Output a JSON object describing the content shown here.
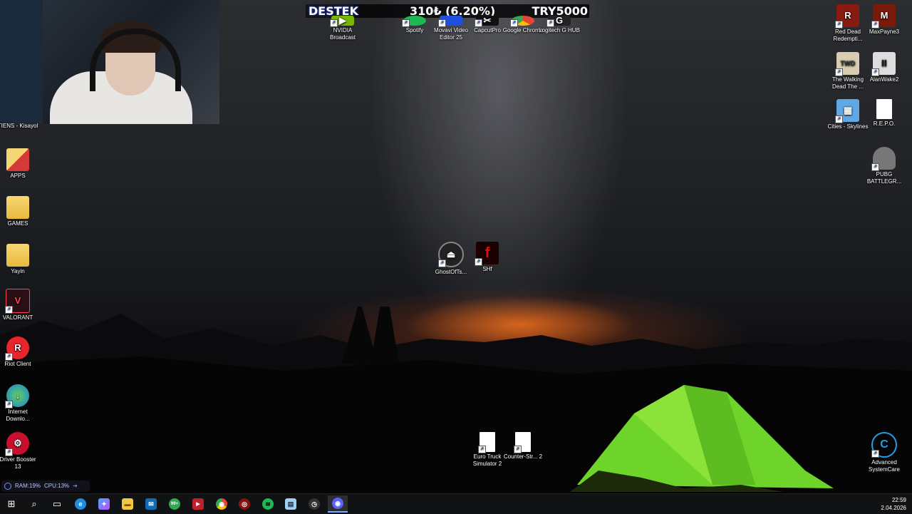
{
  "desktop_left": [
    {
      "label": "TIENS - Kisayol",
      "icon": "tiens-shortcut-icon"
    },
    {
      "label": "APPS",
      "icon": "apps-folder-icon"
    },
    {
      "label": "GAMES",
      "icon": "games-folder-icon"
    },
    {
      "label": "Yayin",
      "icon": "yayin-folder-icon"
    },
    {
      "label": "VALORANT",
      "icon": "valorant-icon"
    },
    {
      "label": "Riot Client",
      "icon": "riot-client-icon"
    },
    {
      "label": "Internet Downlo...",
      "icon": "internet-download-manager-icon"
    },
    {
      "label": "Driver Booster 13",
      "icon": "driver-booster-icon"
    }
  ],
  "desktop_top": [
    {
      "label": "NVIDIA Broadcast",
      "icon": "nvidia-broadcast-icon"
    },
    {
      "label": "Spotify",
      "icon": "spotify-icon"
    },
    {
      "label": "Movavi Video Editor 25",
      "icon": "movavi-icon"
    },
    {
      "label": "CapcutPro",
      "icon": "capcut-icon"
    },
    {
      "label": "Google Chrome",
      "icon": "chrome-icon"
    },
    {
      "label": "Logitech G HUB",
      "icon": "logitech-ghub-icon"
    }
  ],
  "desktop_center": [
    {
      "label": "GhostOfTs...",
      "icon": "ghost-of-tsushima-icon"
    },
    {
      "label": "SHf",
      "icon": "shf-icon"
    }
  ],
  "desktop_bottom": [
    {
      "label": "Euro Truck Simulator 2",
      "icon": "file-icon"
    },
    {
      "label": "Counter-Str... 2",
      "icon": "file-icon"
    }
  ],
  "desktop_right": [
    {
      "label": "Red Dead Redempti...",
      "icon": "red-dead-icon"
    },
    {
      "label": "MaxPayne3",
      "icon": "max-payne-icon"
    },
    {
      "label": "The Walking Dead The ...",
      "icon": "walking-dead-icon"
    },
    {
      "label": "AlanWake2",
      "icon": "alan-wake-icon"
    },
    {
      "label": "Cities - Skylines",
      "icon": "cities-skylines-icon"
    },
    {
      "label": "R.E.P.O.",
      "icon": "file-icon"
    },
    {
      "label": "PUBG BATTLEGR...",
      "icon": "pubg-icon"
    },
    {
      "label": "Advanced SystemCare",
      "icon": "advanced-systemcare-icon"
    }
  ],
  "banner": {
    "label": "DESTEK",
    "amount": "310₺ (6.20%)",
    "goal": "TRY5000",
    "progress": 0.062
  },
  "perf": {
    "ram": "RAM:19%",
    "cpu": "CPU:13%"
  },
  "taskbar": {
    "items": [
      {
        "name": "start",
        "glyph": "⊞"
      },
      {
        "name": "search",
        "glyph": "⌕"
      },
      {
        "name": "task-view",
        "glyph": "▭"
      },
      {
        "name": "edge",
        "glyph": "e"
      },
      {
        "name": "copilot",
        "glyph": "✦"
      },
      {
        "name": "file-explorer",
        "glyph": "▬"
      },
      {
        "name": "mail",
        "glyph": "✉"
      },
      {
        "name": "whatsapp",
        "glyph": "99+"
      },
      {
        "name": "obs-stream",
        "glyph": "▶"
      },
      {
        "name": "chrome",
        "glyph": "◉"
      },
      {
        "name": "steelseries",
        "glyph": "◎"
      },
      {
        "name": "spotify",
        "glyph": "≋"
      },
      {
        "name": "notepad",
        "glyph": "▤"
      },
      {
        "name": "clock-app",
        "glyph": "◷"
      },
      {
        "name": "discord",
        "glyph": "◉"
      }
    ],
    "time": "22:59",
    "date": "2.04.2026"
  }
}
